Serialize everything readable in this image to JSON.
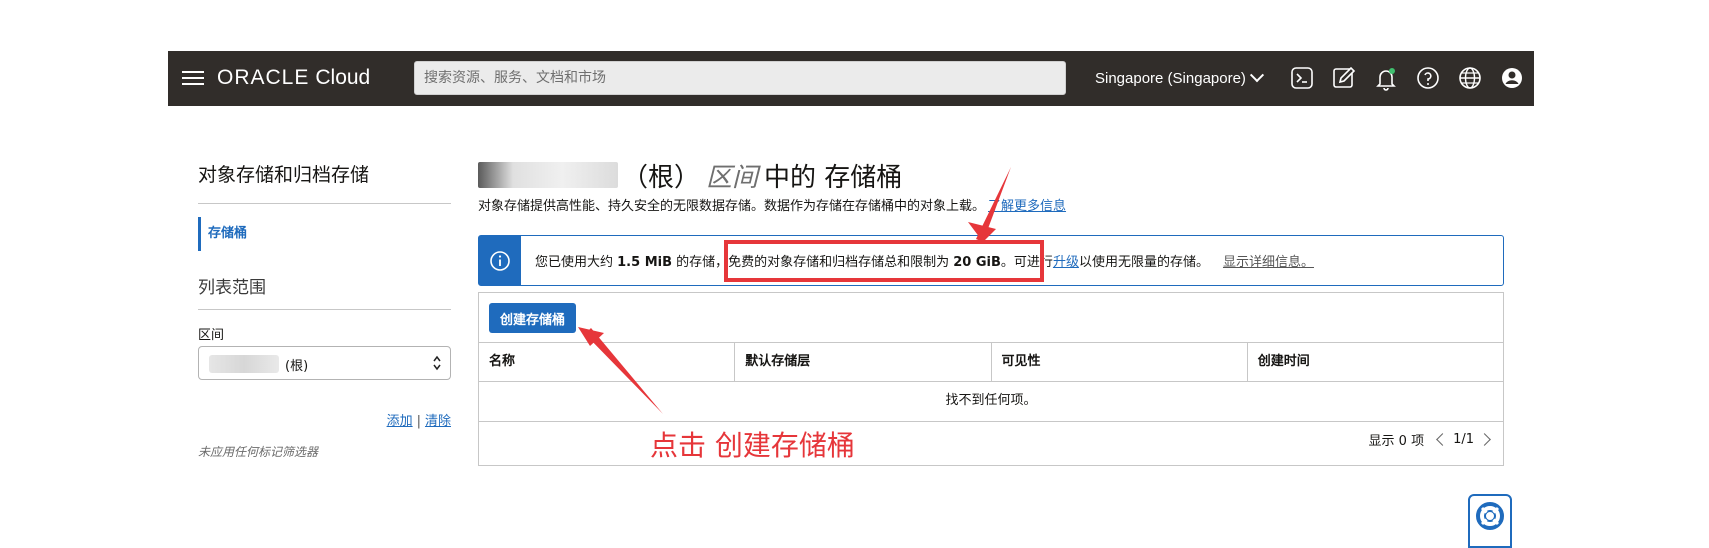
{
  "header": {
    "logo_oracle": "ORACLE",
    "logo_cloud": "Cloud",
    "search_placeholder": "搜索资源、服务、文档和市场",
    "region": "Singapore (Singapore)"
  },
  "sidebar": {
    "title": "对象存储和归档存储",
    "active_item": "存储桶",
    "scope_title": "列表范围",
    "compartment_label": "区间",
    "compartment_value": "(根)",
    "add_link": "添加",
    "link_separator": "|",
    "clear_link": "清除",
    "no_filter_note": "未应用任何标记筛选器"
  },
  "main": {
    "title_root": "（根）",
    "title_compartment": "区间",
    "title_suffix": "中的 存储桶",
    "description": "对象存储提供高性能、持久安全的无限数据存储。数据作为存储在存储桶中的对象上载。",
    "learn_more": "了解更多信息",
    "banner": {
      "prefix": "您已使用大约 ",
      "used": "1.5 MiB",
      "mid": " 的存储，免费的对象存储和归档存储总和限制为 ",
      "limit": "20 GiB",
      "mid2": "。可进行",
      "upgrade": "升级",
      "suffix": "以使用无限量的存储。",
      "details": "显示详细信息。"
    },
    "create_button": "创建存储桶",
    "columns": [
      "名称",
      "默认存储层",
      "可见性",
      "创建时间"
    ],
    "empty_message": "找不到任何项。",
    "showing": "显示 0 项",
    "page": "1/1"
  },
  "annotation": {
    "text": "点击 创建存储桶",
    "color": "#e6363a"
  },
  "colors": {
    "topbar": "#312d2a",
    "accent": "#1f6bbd"
  }
}
